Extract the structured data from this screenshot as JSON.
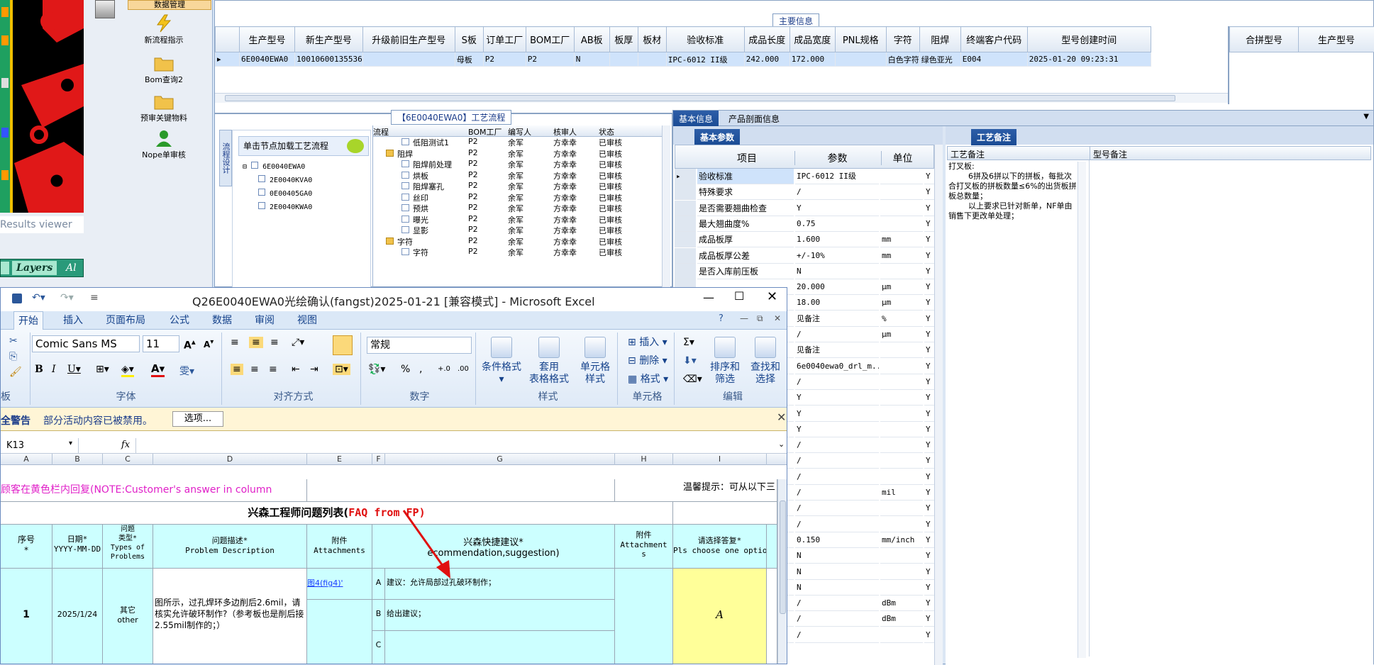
{
  "left": {
    "results_viewer": "Results viewer",
    "layers_tab": "Layers",
    "al_tab": "Al"
  },
  "nav": {
    "top_item": "数据管理",
    "items": [
      {
        "label": "新流程指示",
        "icon": "lightning-icon"
      },
      {
        "label": "Bom查询2",
        "icon": "folder-icon"
      },
      {
        "label": "预审关键物料",
        "icon": "folder-icon"
      },
      {
        "label": "Nope单审核",
        "icon": "user-icon"
      }
    ]
  },
  "main": {
    "section_title": "主要信息",
    "columns": [
      "生产型号",
      "新生产型号",
      "升级前旧生产型号",
      "S板",
      "订单工厂",
      "BOM工厂",
      "AB板",
      "板厚",
      "板材",
      "验收标准",
      "成品长度",
      "成品宽度",
      "PNL规格",
      "字符",
      "阻焊",
      "终端客户代码",
      "型号创建时间"
    ],
    "row": [
      "6E0040EWA0",
      "10010600135536",
      "",
      "母板",
      "P2",
      "P2",
      "N",
      "",
      "",
      "IPC-6012 II级",
      "242.000",
      "172.000",
      "",
      "白色字符",
      "绿色亚光",
      "E004",
      "2025-01-20 09:23:31"
    ],
    "right_columns": [
      "合拼型号",
      "生产型号"
    ]
  },
  "flow": {
    "section_title": "【6E0040EWA0】工艺流程",
    "side_tab": "流程设计",
    "load_hint": "单击节点加载工艺流程",
    "tree_root": "6E0040EWA0",
    "tree_children": [
      "2E0040KVA0",
      "0E00405GA0",
      "2E0040KWA0"
    ],
    "grid_columns": [
      "流程",
      "BOM工厂",
      "编写人",
      "核审人",
      "状态"
    ],
    "grid_rows": [
      {
        "name": "低阻测试1",
        "indent": 3,
        "folder": false,
        "bom": "P2",
        "writer": "余军",
        "checker": "方幸幸",
        "status": "已审核"
      },
      {
        "name": "阻焊",
        "indent": 2,
        "folder": true,
        "bom": "P2",
        "writer": "余军",
        "checker": "方幸幸",
        "status": "已审核"
      },
      {
        "name": "阻焊前处理",
        "indent": 3,
        "folder": false,
        "bom": "P2",
        "writer": "余军",
        "checker": "方幸幸",
        "status": "已审核"
      },
      {
        "name": "烘板",
        "indent": 3,
        "folder": false,
        "bom": "P2",
        "writer": "余军",
        "checker": "方幸幸",
        "status": "已审核"
      },
      {
        "name": "阻焊塞孔",
        "indent": 3,
        "folder": false,
        "bom": "P2",
        "writer": "余军",
        "checker": "方幸幸",
        "status": "已审核"
      },
      {
        "name": "丝印",
        "indent": 3,
        "folder": false,
        "bom": "P2",
        "writer": "余军",
        "checker": "方幸幸",
        "status": "已审核"
      },
      {
        "name": "预烘",
        "indent": 3,
        "folder": false,
        "bom": "P2",
        "writer": "余军",
        "checker": "方幸幸",
        "status": "已审核"
      },
      {
        "name": "曝光",
        "indent": 3,
        "folder": false,
        "bom": "P2",
        "writer": "余军",
        "checker": "方幸幸",
        "status": "已审核"
      },
      {
        "name": "显影",
        "indent": 3,
        "folder": false,
        "bom": "P2",
        "writer": "余军",
        "checker": "方幸幸",
        "status": "已审核"
      },
      {
        "name": "字符",
        "indent": 2,
        "folder": true,
        "bom": "P2",
        "writer": "余军",
        "checker": "方幸幸",
        "status": "已审核"
      },
      {
        "name": "字符",
        "indent": 3,
        "folder": false,
        "bom": "P2",
        "writer": "余军",
        "checker": "方幸幸",
        "status": "已审核"
      }
    ]
  },
  "basic": {
    "tab1": "基本信息",
    "tab2": "产品剖面信息",
    "sub_tab": "基本参数",
    "columns": [
      "项目",
      "参数",
      "单位"
    ],
    "rows": [
      {
        "item": "验收标准",
        "param": "IPC-6012 II级",
        "unit": "",
        "flag": "Y"
      },
      {
        "item": "特殊要求",
        "param": "/",
        "unit": "",
        "flag": "Y"
      },
      {
        "item": "是否需要翘曲检查",
        "param": "Y",
        "unit": "",
        "flag": "Y"
      },
      {
        "item": "最大翘曲度%",
        "param": "0.75",
        "unit": "",
        "flag": "Y"
      },
      {
        "item": "成品板厚",
        "param": "1.600",
        "unit": "mm",
        "flag": "Y"
      },
      {
        "item": "成品板厚公差",
        "param": "+/-10%",
        "unit": "mm",
        "flag": "Y"
      },
      {
        "item": "是否入库前压板",
        "param": "N",
        "unit": "",
        "flag": "Y"
      },
      {
        "item": "",
        "param": "20.000",
        "unit": "μm",
        "flag": "Y"
      },
      {
        "item": "",
        "param": "18.00",
        "unit": "μm",
        "flag": "Y"
      },
      {
        "item": "",
        "param": "见备注",
        "unit": "%",
        "flag": "Y"
      },
      {
        "item": "",
        "param": "/",
        "unit": "μm",
        "flag": "Y"
      },
      {
        "item": "",
        "param": "见备注",
        "unit": "",
        "flag": "Y"
      },
      {
        "item": "",
        "param": "6e0040ewa0_drl_m...",
        "unit": "",
        "flag": "Y"
      },
      {
        "item": "",
        "param": "/",
        "unit": "",
        "flag": "Y"
      },
      {
        "item": "",
        "param": "Y",
        "unit": "",
        "flag": "Y"
      },
      {
        "item": "",
        "param": "Y",
        "unit": "",
        "flag": "Y"
      },
      {
        "item": "",
        "param": "Y",
        "unit": "",
        "flag": "Y"
      },
      {
        "item": "",
        "param": "/",
        "unit": "",
        "flag": "Y"
      },
      {
        "item": "",
        "param": "/",
        "unit": "",
        "flag": "Y"
      },
      {
        "item": "",
        "param": "/",
        "unit": "",
        "flag": "Y"
      },
      {
        "item": "",
        "param": "/",
        "unit": "mil",
        "flag": "Y"
      },
      {
        "item": "",
        "param": "/",
        "unit": "",
        "flag": "Y"
      },
      {
        "item": "",
        "param": "/",
        "unit": "",
        "flag": "Y"
      },
      {
        "item": "",
        "param": "0.150",
        "unit": "mm/inch",
        "flag": "Y"
      },
      {
        "item": "",
        "param": "N",
        "unit": "",
        "flag": "Y"
      },
      {
        "item": "",
        "param": "N",
        "unit": "",
        "flag": "Y"
      },
      {
        "item": "",
        "param": "N",
        "unit": "",
        "flag": "Y"
      },
      {
        "item": "",
        "param": "/",
        "unit": "dBm",
        "flag": "Y"
      },
      {
        "item": "",
        "param": "/",
        "unit": "dBm",
        "flag": "Y"
      },
      {
        "item": "",
        "param": "/",
        "unit": "",
        "flag": "Y"
      }
    ]
  },
  "process_notes": {
    "tab": "工艺备注",
    "col1": "工艺备注",
    "col2": "型号备注",
    "note": "打叉板:\n        6拼及6拼以下的拼板，每批次合打叉板的拼板数量≤6%的出货板拼板总数量；\n        以上要求已针对新单，NF单由销售下更改单处理；"
  },
  "excel": {
    "title": "Q26E0040EWA0光绘确认(fangst)2025-01-21  [兼容模式] - Microsoft Excel",
    "tabs": [
      "开始",
      "插入",
      "页面布局",
      "公式",
      "数据",
      "审阅",
      "视图"
    ],
    "font_name": "Comic Sans MS",
    "font_size": "11",
    "number_format": "常规",
    "group_labels": {
      "clipboard": "板",
      "font": "字体",
      "align": "对齐方式",
      "number": "数字",
      "styles": "样式",
      "cells": "单元格",
      "edit": "编辑"
    },
    "styles_buttons": [
      "条件格式",
      "套用\n表格格式",
      "单元格\n样式"
    ],
    "cells_buttons": [
      "插入",
      "删除",
      "格式"
    ],
    "edit_buttons": [
      "排序和\n筛选",
      "查找和\n选择"
    ],
    "security_label": "全警告",
    "security_text": "部分活动内容已被禁用。",
    "options_button": "选项...",
    "name_box": "K13",
    "fx": "fx",
    "col_letters": [
      "A",
      "B",
      "C",
      "D",
      "E",
      "F",
      "G",
      "H",
      "I"
    ],
    "note_pink": "顾客在黄色栏内回复(NOTE:Customer's answer in column yellow area)",
    "note_right": "温馨提示：可从以下三",
    "table_title": "兴森工程师问题列表(",
    "table_title_red": "FAQ from FP)",
    "headers": {
      "seq": "序号\n*",
      "date": "日期*\nYYYY-MM-DD",
      "type": "问题\n类型*\nTypes of\nProblems",
      "desc": "问题描述*\nProblem Description",
      "att": "附件\nAttachments",
      "sugg": "兴森快捷建议*\necommendation,suggestion)",
      "att2": "附件\nAttachment\ns",
      "choose": "请选择答复*\nPls choose one option"
    },
    "row": {
      "seq": "1",
      "date": "2025/1/24",
      "type": "其它\nother",
      "desc": "图所示，过孔焊环多边削后2.6mil，请核实允许破环制作?（参考板也是削后接2.55mil制作的；）",
      "att": "图4(fig4)'",
      "opt_a": "A",
      "sugg_a": "建议：允许局部过孔破环制作；",
      "opt_b": "B",
      "sugg_b": "给出建议；",
      "opt_c": "C",
      "answer": "A"
    }
  },
  "colors": {
    "yellow": "#ffff99",
    "cyan": "#ccffff",
    "pink_text": "#e020c8",
    "red": "#e01010",
    "blue_tab": "#1a4b94"
  }
}
